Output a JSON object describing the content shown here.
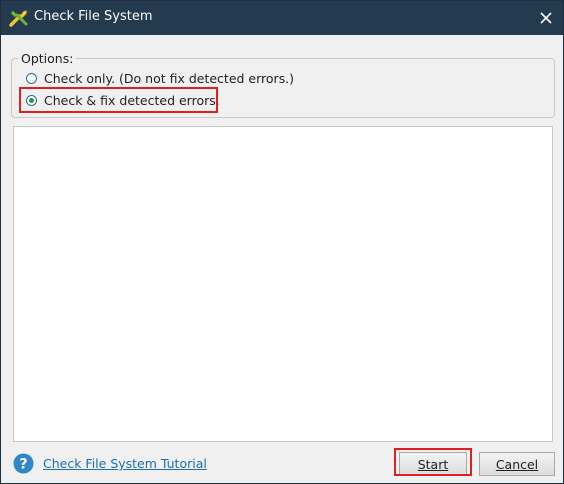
{
  "window": {
    "title": "Check File System"
  },
  "options": {
    "legend": "Options:",
    "items": [
      {
        "label": "Check only. (Do not fix detected errors.)",
        "checked": false
      },
      {
        "label": "Check & fix detected errors.",
        "checked": true
      }
    ]
  },
  "footer": {
    "tutorial_link": "Check File System Tutorial",
    "start_label": "Start",
    "cancel_label": "Cancel"
  },
  "icons": {
    "app": "wrench-screwdriver-icon",
    "close": "close-icon",
    "help": "question-circle-icon"
  },
  "colors": {
    "titlebar": "#233a4f",
    "highlight": "#e02020",
    "link": "#1a6fb5",
    "radio_checked": "#1f9a3a"
  }
}
